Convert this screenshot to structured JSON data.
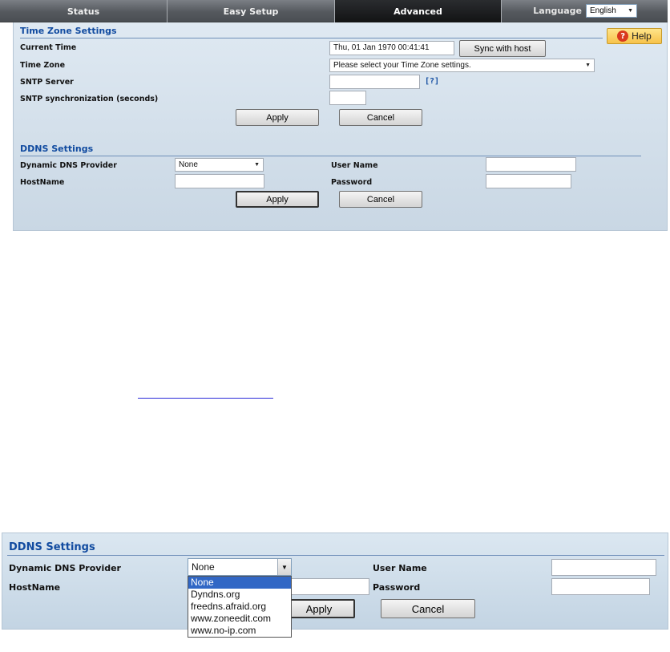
{
  "nav": {
    "tabs": [
      {
        "label": "Status"
      },
      {
        "label": "Easy Setup"
      },
      {
        "label": "Advanced"
      }
    ],
    "language_label": "Language",
    "language_value": "English"
  },
  "time_zone": {
    "title": "Time Zone Settings",
    "help_label": "Help",
    "current_time_label": "Current Time",
    "current_time_value": "Thu, 01 Jan 1970 00:41:41",
    "sync_button": "Sync with host",
    "time_zone_label": "Time Zone",
    "time_zone_value": "Please select your Time Zone settings.",
    "sntp_server_label": "SNTP Server",
    "sntp_server_value": "",
    "sntp_hint": "[?]",
    "sntp_sync_label": "SNTP synchronization (seconds)",
    "sntp_sync_value": "",
    "apply_button": "Apply",
    "cancel_button": "Cancel"
  },
  "ddns": {
    "title": "DDNS Settings",
    "provider_label": "Dynamic DNS Provider",
    "provider_value": "None",
    "hostname_label": "HostName",
    "hostname_value": "",
    "username_label": "User Name",
    "username_value": "",
    "password_label": "Password",
    "password_value": "",
    "apply_button": "Apply",
    "cancel_button": "Cancel"
  },
  "ddns_zoom": {
    "title": "DDNS Settings",
    "provider_label": "Dynamic DNS Provider",
    "provider_value": "None",
    "hostname_label": "HostName",
    "username_label": "User Name",
    "password_label": "Password",
    "apply_button": "Apply",
    "cancel_button": "Cancel",
    "options": [
      "None",
      "Dyndns.org",
      "freedns.afraid.org",
      "www.zoneedit.com",
      "www.no-ip.com"
    ],
    "selected_option": "None"
  },
  "colors": {
    "accent": "#114ba0",
    "active_tab": "#121314",
    "help_button": "#f7c24a",
    "selection": "#3167c5"
  },
  "icons": {
    "help": "help-icon",
    "dropdown": "chevron-down-icon"
  }
}
